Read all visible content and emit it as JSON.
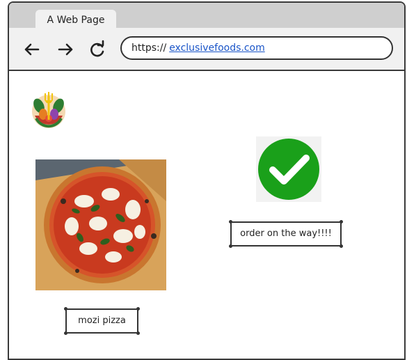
{
  "browser": {
    "tab_title": "A Web Page",
    "url_protocol": "https://",
    "url_domain": "exclusivefoods.com"
  },
  "nav": {
    "back_icon": "arrow-left-icon",
    "forward_icon": "arrow-right-icon",
    "reload_icon": "reload-icon"
  },
  "page": {
    "logo": "food-logo",
    "product_image": "pizza-image",
    "product_name": "mozi pizza",
    "status_icon": "green-checkmark-icon",
    "status_text": "order on the way!!!!"
  },
  "colors": {
    "check_green": "#1aa01a",
    "link_blue": "#1a55c8"
  }
}
